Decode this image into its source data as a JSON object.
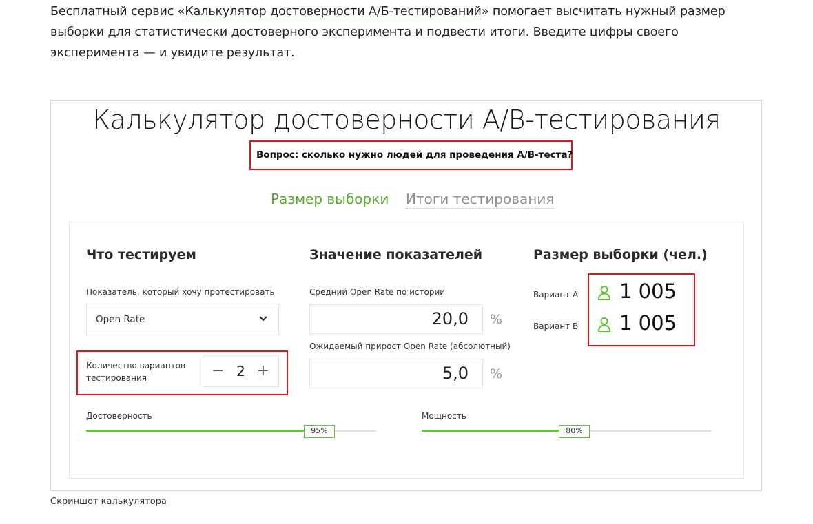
{
  "intro": {
    "before": "Бесплатный сервис «",
    "link": "Калькулятор достоверности А/Б-тестирований",
    "after": "» помогает высчитать нужный размер выборки для статистически достоверного эксперимента и подвести итоги. Введите цифры своего эксперимента — и увидите результат."
  },
  "calc": {
    "title": "Калькулятор достоверности А/В-тестирования",
    "question": "Вопрос: сколько нужно людей для проведения А/В-теста?",
    "tabs": [
      "Размер выборки",
      "Итоги тестирования"
    ],
    "columns": {
      "what": "Что тестируем",
      "values": "Значение показателей",
      "sample": "Размер выборки (чел.)"
    },
    "metric_label": "Показатель, который хочу протестировать",
    "metric_selected": "Open Rate",
    "variants_label_1": "Количество вариантов",
    "variants_label_2": "тестирования",
    "variants_count": "2",
    "minus": "−",
    "plus": "+",
    "avg_label": "Средний Open Rate по истории",
    "avg_value": "20,0",
    "growth_label": "Ожидаемый прирост Open Rate (абсолютный)",
    "growth_value": "5,0",
    "percent": "%",
    "variant_a_label": "Вариант А",
    "variant_a_value": "1 005",
    "variant_b_label": "Вариант В",
    "variant_b_value": "1 005",
    "confidence_label": "Достоверность",
    "confidence_value": "95%",
    "power_label": "Мощность",
    "power_value": "80%"
  },
  "caption": "Скриншот калькулятора",
  "colors": {
    "accent": "#5ec435",
    "highlight": "#e3141b"
  }
}
